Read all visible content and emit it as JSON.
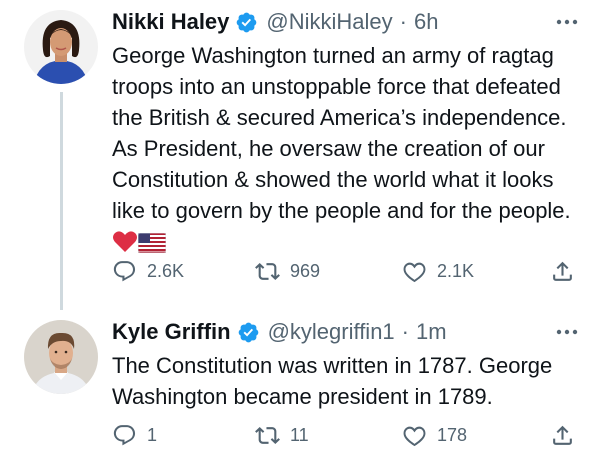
{
  "tweets": [
    {
      "name": "Nikki Haley",
      "handle": "@NikkiHaley",
      "separator": "·",
      "time": "6h",
      "text": "George Washington turned an army of ragtag troops into an unstoppable force that defeated the British & secured America’s independence. As President, he oversaw the creation of our Constitution & showed the world what it looks like to govern by the people and for the people.",
      "emoji": [
        "red-heart",
        "us-flag"
      ],
      "reply_count": "2.6K",
      "retweet_count": "969",
      "like_count": "2.1K"
    },
    {
      "name": "Kyle Griffin",
      "handle": "@kylegriffin1",
      "separator": "·",
      "time": "1m",
      "text": "The Constitution was written in 1787. George Washington became president in 1789.",
      "reply_count": "1",
      "retweet_count": "11",
      "like_count": "178"
    }
  ],
  "icons": {
    "verified": "verified-badge-icon",
    "more": "more-dots-icon",
    "reply": "reply-icon",
    "retweet": "retweet-icon",
    "like": "heart-icon",
    "share": "share-icon"
  },
  "colors": {
    "verified_blue": "#1d9bf0",
    "text_primary": "#0f1419",
    "text_secondary": "#536471",
    "thread_line": "#cfd9de",
    "heart_red": "#dd2e44"
  }
}
